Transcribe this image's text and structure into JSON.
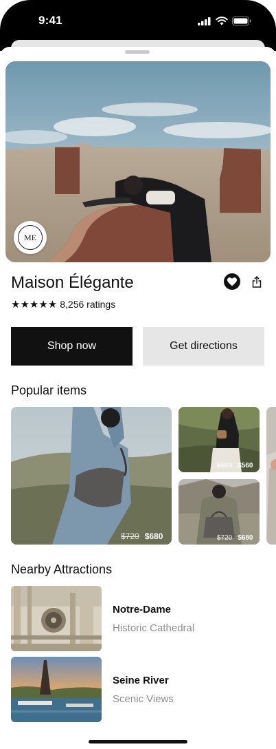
{
  "status_bar": {
    "time": "9:41"
  },
  "store": {
    "logo_text": "ME",
    "name": "Maison Élégante",
    "stars": "★★★★★",
    "ratings": "8,256 ratings"
  },
  "actions": {
    "shop_now": "Shop now",
    "get_directions": "Get directions"
  },
  "popular": {
    "title": "Popular items",
    "items": [
      {
        "old_price": "$720",
        "new_price": "$680"
      },
      {
        "old_price": "$590",
        "new_price": "$560"
      },
      {
        "old_price": "$720",
        "new_price": "$680"
      }
    ]
  },
  "nearby": {
    "title": "Nearby Attractions",
    "items": [
      {
        "name": "Notre-Dame",
        "subtitle": "Historic Cathedral"
      },
      {
        "name": "Seine River",
        "subtitle": "Scenic Views"
      }
    ]
  }
}
